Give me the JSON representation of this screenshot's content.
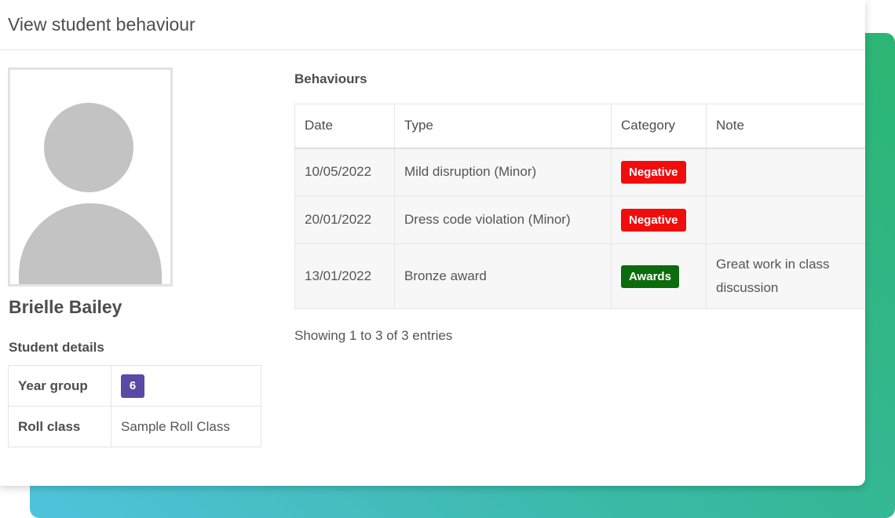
{
  "window": {
    "title": "View student behaviour"
  },
  "student": {
    "name": "Brielle Bailey",
    "details_heading": "Student details",
    "details": [
      {
        "label": "Year group",
        "value": "6",
        "value_style": "badge",
        "badge_color": "#5b4aa5"
      },
      {
        "label": "Roll class",
        "value": "Sample Roll Class"
      }
    ],
    "avatar_icon": "user-silhouette-icon"
  },
  "behaviours": {
    "heading": "Behaviours",
    "columns": [
      "Date",
      "Type",
      "Category",
      "Note"
    ],
    "rows": [
      {
        "date": "10/05/2022",
        "type": "Mild disruption (Minor)",
        "category": "Negative",
        "category_color": "#f20d0d",
        "note": ""
      },
      {
        "date": "20/01/2022",
        "type": "Dress code violation (Minor)",
        "category": "Negative",
        "category_color": "#f20d0d",
        "note": ""
      },
      {
        "date": "13/01/2022",
        "type": "Bronze award",
        "category": "Awards",
        "category_color": "#0c6b0c",
        "note": "Great work in class discussion"
      }
    ],
    "footer": "Showing 1 to 3 of 3 entries"
  },
  "colors": {
    "backdrop_gradient_start": "#4fc3dc",
    "backdrop_gradient_end": "#2bb572"
  }
}
